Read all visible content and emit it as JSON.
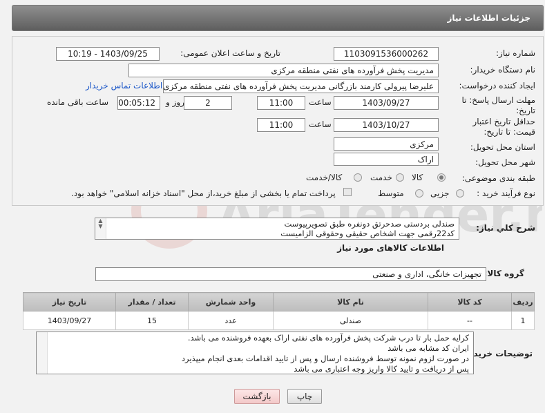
{
  "header": {
    "title": "جزئیات اطلاعات نیاز"
  },
  "labels": {
    "need_number": "شماره نیاز:",
    "announce_datetime": "تاریخ و ساعت اعلان عمومی:",
    "buyer_org": "نام دستگاه خریدار:",
    "requester": "ایجاد کننده درخواست:",
    "reply_deadline": "مهلت ارسال پاسخ: تا تاریخ:",
    "time": "ساعت",
    "day_and": "روز و",
    "remaining": "ساعت باقی مانده",
    "price_validity": "حداقل تاریخ اعتبار قیمت: تا تاریخ:",
    "province": "استان محل تحویل:",
    "city": "شهر محل تحویل:",
    "category": "طبقه بندی موضوعی:",
    "process_type": "نوع فرآیند خرید :",
    "general_desc": "شرح کلي نياز:",
    "items_info": "اطلاعات کالاهای مورد نیاز",
    "goods_group": "گروه کالا:",
    "buyer_notes": "توضیحات خریدار:"
  },
  "values": {
    "need_number": "1103091536000262",
    "announce_datetime": "1403/09/25 - 10:19",
    "buyer_org": "مدیریت پخش فرآورده های نفتی منطقه مرکزی",
    "requester": "علیرضا پیرولی کارمند بازرگانی مدیریت پخش فرآورده های نفتی منطقه مرکزی",
    "contact_link": "اطلاعات تماس خریدار",
    "reply_date": "1403/09/27",
    "reply_time": "11:00",
    "days": "2",
    "remaining_time": "00:05:12",
    "validity_date": "1403/10/27",
    "validity_time": "11:00",
    "province": "مرکزی",
    "city": "اراک",
    "goods_group": "تجهیزات خانگی، اداری و صنعتی"
  },
  "category_options": [
    "کالا",
    "خدمت",
    "کالا/خدمت"
  ],
  "category_selected": "کالا",
  "process_options": [
    "جزیی",
    "متوسط"
  ],
  "process_selected": "جزیی",
  "payment_note": "پرداخت تمام یا بخشی از مبلغ خرید،از محل \"اسناد خزانه اسلامی\" خواهد بود.",
  "general_desc": [
    "صندلی بردستی صدحرتق دونفره طبق تصویرپیوست",
    "کد22رقمی  جهت اشخاص حقیقی وحقوقی الزامیست"
  ],
  "table": {
    "headers": [
      "ردیف",
      "کد کالا",
      "نام کالا",
      "واحد شمارش",
      "تعداد / مقدار",
      "تاریخ نیاز"
    ],
    "rows": [
      [
        "1",
        "--",
        "صندلی",
        "عدد",
        "15",
        "1403/09/27"
      ]
    ]
  },
  "buyer_notes": [
    "کرایه حمل بار تا درب شرکت  پخش فرآورده های نفتی اراک بعهده فروشنده می باشد.",
    "ایران کد مشابه می باشد",
    "در صورت لزوم نمونه توسط فروشنده ارسال و پس از تایید اقدامات بعدی انجام میپذیرد",
    "پس از دریافت و تایید کالا واریز وجه اعتباری می باشد"
  ],
  "buttons": {
    "print": "چاپ",
    "back": "بازگشت"
  },
  "watermark": "AriaTender.neT"
}
